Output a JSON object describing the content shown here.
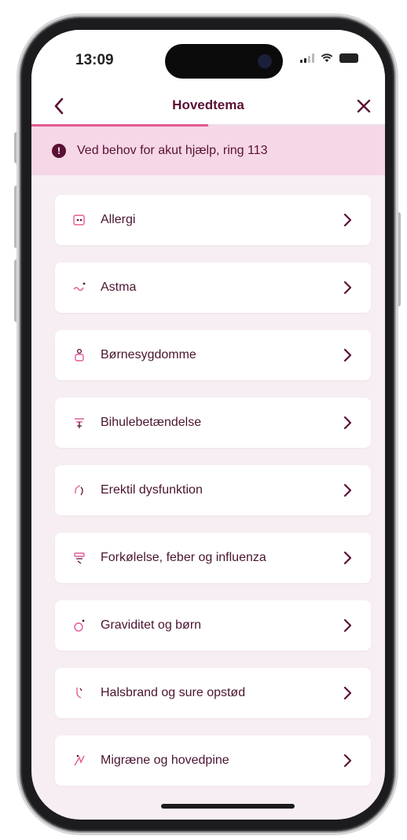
{
  "status_bar": {
    "time": "13:09"
  },
  "nav": {
    "title": "Hovedtema",
    "back_icon": "chevron-left-icon",
    "close_icon": "close-icon",
    "progress_fraction": 0.5
  },
  "alert": {
    "icon": "info-icon",
    "icon_glyph": "!",
    "text": "Ved behov for akut hjælp, ring 113"
  },
  "topics": [
    {
      "label": "Allergi",
      "icon": "allergy-icon"
    },
    {
      "label": "Astma",
      "icon": "asthma-icon"
    },
    {
      "label": "Børnesygdomme",
      "icon": "child-illness-icon"
    },
    {
      "label": "Bihulebetændelse",
      "icon": "sinusitis-icon"
    },
    {
      "label": "Erektil dysfunktion",
      "icon": "erectile-dysfunction-icon"
    },
    {
      "label": "Forkølelse, feber og influenza",
      "icon": "cold-flu-icon"
    },
    {
      "label": "Graviditet og børn",
      "icon": "pregnancy-icon"
    },
    {
      "label": "Halsbrand og sure opstød",
      "icon": "heartburn-icon"
    },
    {
      "label": "Migræne og hovedpine",
      "icon": "migraine-icon"
    }
  ],
  "colors": {
    "brand": "#5a1134",
    "accent": "#e35a96",
    "banner_bg": "#f5d7e6",
    "page_bg": "#f6eef2"
  }
}
